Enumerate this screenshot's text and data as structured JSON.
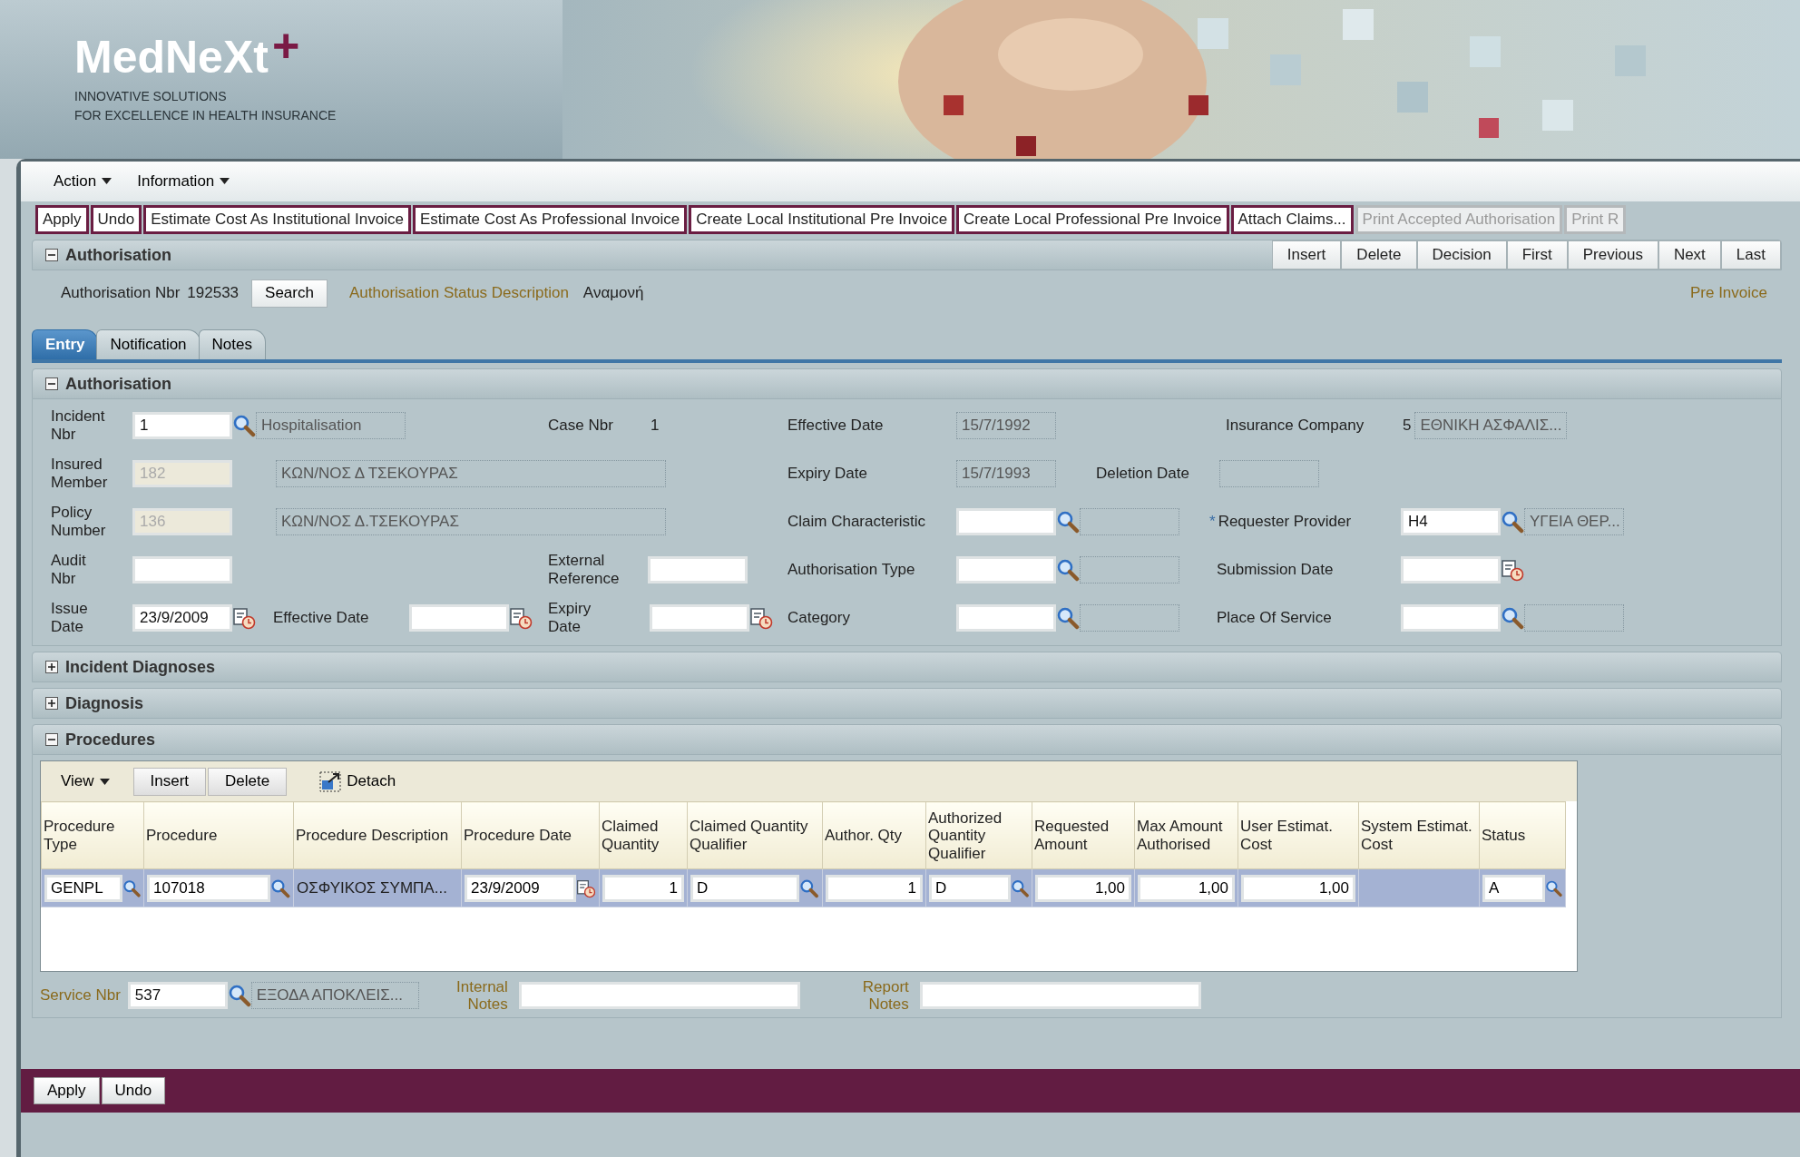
{
  "header": {
    "logo": "MedNeXt",
    "logo_mark": "+",
    "tagline": [
      "INNOVATIVE SOLUTIONS",
      "FOR EXCELLENCE IN HEALTH INSURANCE"
    ],
    "banner": {
      "kind": "picture"
    }
  },
  "menu": [
    {
      "label": "Action"
    },
    {
      "label": "Information"
    }
  ],
  "toolbar": [
    {
      "label": "Apply",
      "disabled": false
    },
    {
      "label": "Undo",
      "disabled": false
    },
    {
      "label": "Estimate Cost As Institutional Invoice",
      "disabled": false
    },
    {
      "label": "Estimate Cost As Professional Invoice",
      "disabled": false
    },
    {
      "label": "Create Local Institutional Pre Invoice",
      "disabled": false
    },
    {
      "label": "Create Local Professional Pre Invoice",
      "disabled": false
    },
    {
      "label": "Attach Claims...",
      "disabled": false
    },
    {
      "label": "Print Accepted Authorisation",
      "disabled": true
    },
    {
      "label": "Print R",
      "disabled": true
    }
  ],
  "authorisation": {
    "title": "Authorisation",
    "expanded": true,
    "nav_buttons": [
      "Insert",
      "Delete",
      "Decision",
      "First",
      "Previous",
      "Next",
      "Last"
    ],
    "nbr_label": "Authorisation Nbr",
    "nbr": "192533",
    "search_button": "Search",
    "status_label": "Authorisation Status Description",
    "status": "Αναμονή",
    "pre_invoice": "Pre Invoice"
  },
  "tabs": [
    {
      "label": "Entry",
      "selected": true
    },
    {
      "label": "Notification",
      "selected": false
    },
    {
      "label": "Notes",
      "selected": false
    }
  ],
  "entry": {
    "title": "Authorisation",
    "expanded": true,
    "fields": [
      {
        "label": "Incident Nbr",
        "kind": "lookup",
        "value": "1",
        "description": "Hospitalisation"
      },
      {
        "label": "Case Nbr",
        "kind": "text",
        "value": "1"
      },
      {
        "label": "Effective Date",
        "kind": "readonly",
        "value": "15/7/1992"
      },
      {
        "label": "Insurance Company",
        "kind": "company",
        "value": "5",
        "description": "ΕΘΝΙΚΗ ΑΣΦΑΛΙΣ..."
      },
      {
        "label": "Insured Member",
        "kind": "member",
        "value": "182",
        "disabled": true,
        "description": "ΚΩΝ/ΝΟΣ Δ ΤΣΕΚΟΥΡΑΣ"
      },
      {
        "label": "Expiry Date",
        "kind": "readonly",
        "value": "15/7/1993"
      },
      {
        "label": "Deletion Date",
        "kind": "readonly"
      },
      {
        "label": "Policy Number",
        "kind": "member",
        "value": "136",
        "disabled": true,
        "description": "ΚΩΝ/ΝΟΣ Δ.ΤΣΕΚΟΥΡΑΣ"
      },
      {
        "label": "Claim Characteristic",
        "kind": "lookup"
      },
      {
        "label": "Requester Provider",
        "required_mark": "*",
        "kind": "lookup",
        "value": "H4",
        "description": "ΥΓΕΙΑ ΘΕΡ..."
      },
      {
        "label": "Audit Nbr",
        "kind": "input"
      },
      {
        "label": "External Reference",
        "kind": "input"
      },
      {
        "label": "Authorisation Type",
        "kind": "lookup"
      },
      {
        "label": "Submission Date",
        "kind": "date"
      },
      {
        "label": "Issue Date",
        "kind": "date",
        "value": "23/9/2009"
      },
      {
        "label": "Effective Date",
        "kind": "date"
      },
      {
        "label": "Expiry Date",
        "kind": "date"
      },
      {
        "label": "Category",
        "kind": "lookup"
      },
      {
        "label": "Place Of Service",
        "kind": "lookup"
      }
    ]
  },
  "sections": [
    {
      "title": "Incident Diagnoses",
      "expanded": false
    },
    {
      "title": "Diagnosis",
      "expanded": false
    }
  ],
  "procedures": {
    "title": "Procedures",
    "expanded": true,
    "view_menu": "View",
    "buttons": [
      "Insert",
      "Delete"
    ],
    "detach": "Detach",
    "columns": [
      "Procedure Type",
      "Procedure",
      "Procedure Description",
      "Procedure Date",
      "Claimed Quantity",
      "Claimed Quantity Qualifier",
      "Author. Qty",
      "Authorized Quantity Qualifier",
      "Requested Amount",
      "Max Amount Authorised",
      "User Estimat. Cost",
      "System Estimat. Cost",
      "Status"
    ],
    "rows": [
      {
        "selected": true,
        "cells": [
          {
            "kind": "lookup",
            "value": "GENPL"
          },
          {
            "kind": "lookup",
            "value": "107018"
          },
          {
            "kind": "text",
            "value": "ΟΣΦΥΙΚΟΣ ΣΥΜΠΑ..."
          },
          {
            "kind": "date",
            "value": "23/9/2009"
          },
          {
            "kind": "number",
            "value": "1"
          },
          {
            "kind": "lookup",
            "value": "D"
          },
          {
            "kind": "number",
            "value": "1"
          },
          {
            "kind": "lookup",
            "value": "D"
          },
          {
            "kind": "number",
            "value": "1,00"
          },
          {
            "kind": "number",
            "value": "1,00"
          },
          {
            "kind": "number",
            "value": "1,00"
          },
          {
            "kind": "blank"
          },
          {
            "kind": "lookup",
            "value": "A"
          }
        ]
      }
    ]
  },
  "service": {
    "label": "Service Nbr",
    "value": "537",
    "description": "ΕΞΟΔΑ ΑΠΟΚΛΕΙΣ...",
    "internal_notes_label": "Internal Notes",
    "report_notes_label": "Report Notes"
  },
  "footer_buttons": [
    "Apply",
    "Undo"
  ]
}
